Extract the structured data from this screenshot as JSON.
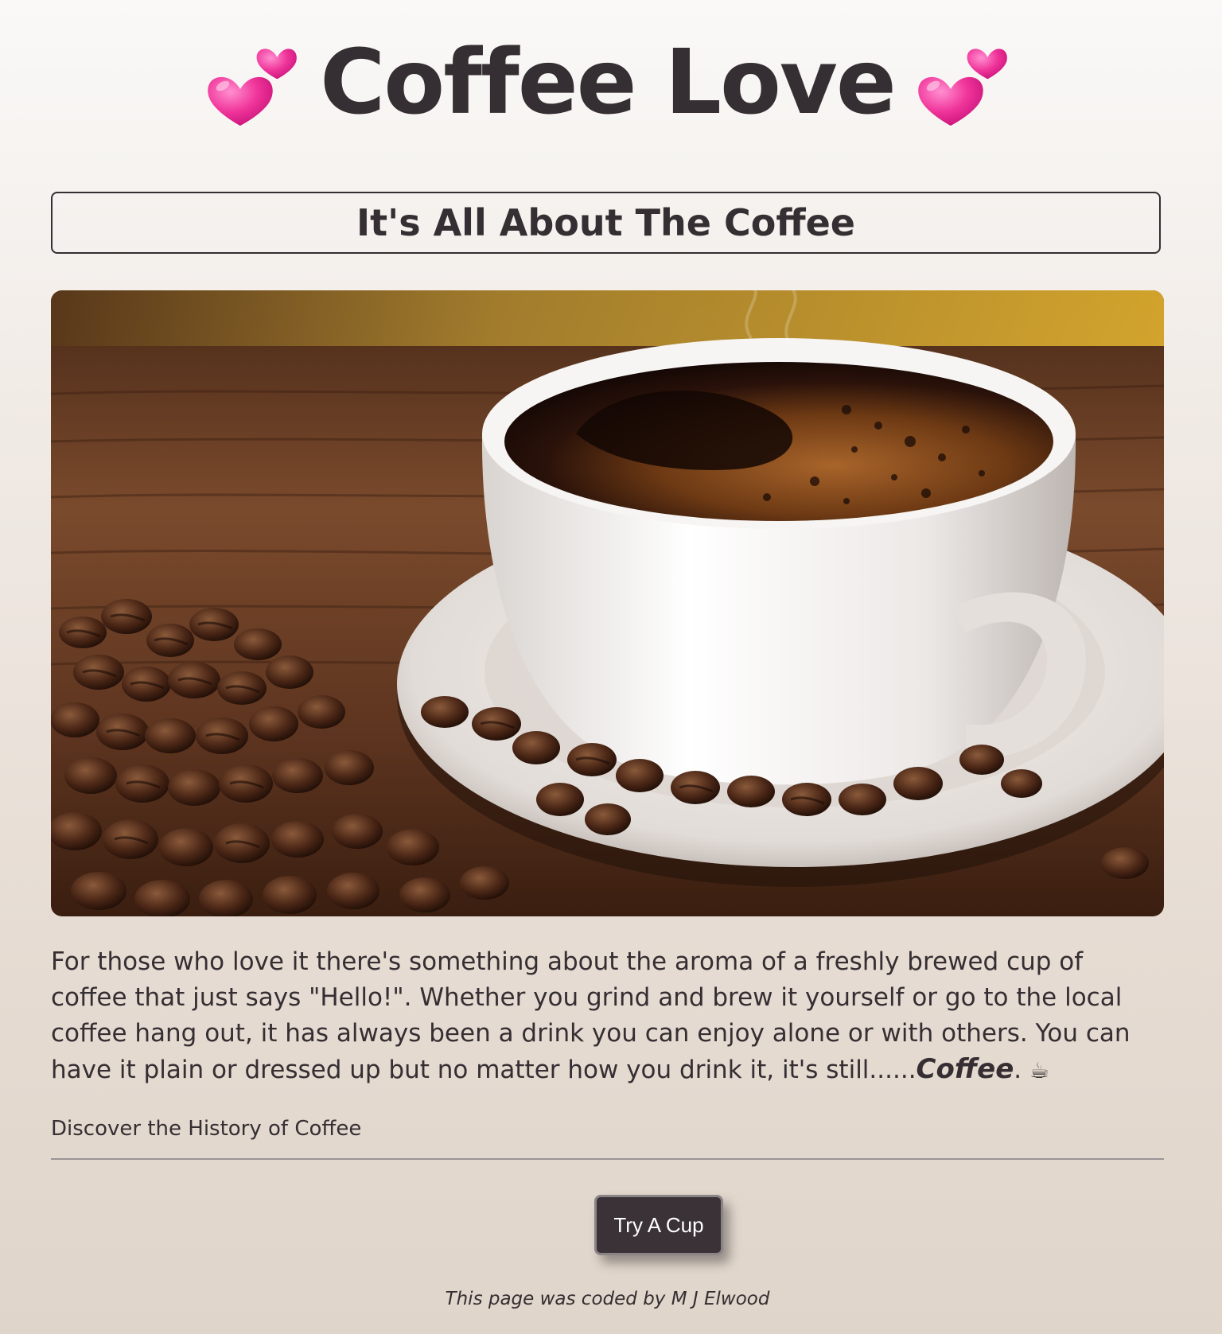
{
  "header": {
    "title": "Coffee Love",
    "left_icon": "two-hearts-icon",
    "right_icon": "two-hearts-icon",
    "heart_color": "#f0359a"
  },
  "subheading": "It's All About The Coffee",
  "hero_image": {
    "subject": "steaming cup of black coffee on a saucer with roasted coffee beans on a wooden table"
  },
  "intro": {
    "text": "For those who love it there's something about the aroma of a freshly brewed cup of coffee that just says \"Hello!\". Whether you grind and brew it yourself or go to the local coffee hang out, it has always been a drink you can enjoy alone or with others. You can have it plain or dressed up but no matter how you drink it, it's still......",
    "emphasis": "Coffee",
    "trailing": ".",
    "emoji": "☕"
  },
  "history_link": "Discover the History of Coffee",
  "cta_button": "Try A Cup",
  "footer": "This page was coded by M J Elwood",
  "colors": {
    "text": "#352e32",
    "button_bg": "#3a3236",
    "button_text": "#ffffff"
  }
}
